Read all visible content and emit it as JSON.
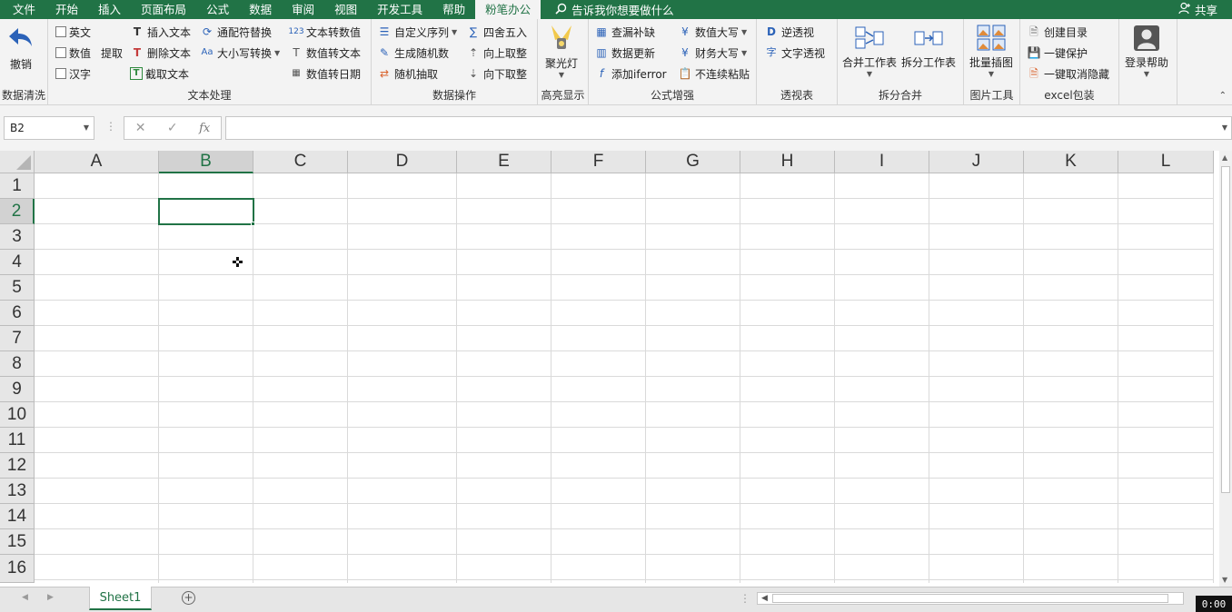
{
  "menu": {
    "items": [
      "文件",
      "开始",
      "插入",
      "页面布局",
      "公式",
      "数据",
      "审阅",
      "视图",
      "开发工具",
      "帮助",
      "粉笔办公"
    ],
    "active_index": 10,
    "search_text": "告诉我你想要做什么",
    "share_label": "共享"
  },
  "ribbon": {
    "clean": {
      "undo_label": "撤销",
      "group_label": "数据清洗"
    },
    "text": {
      "check_english": "英文",
      "check_number": "数值",
      "check_chinese": "汉字",
      "extract": "提取",
      "insert_text": "插入文本",
      "delete_text": "删除文本",
      "cut_text": "截取文本",
      "wildcard": "通配符替换",
      "case_convert": "大小写转换",
      "text_to_num": "文本转数值",
      "num_to_text": "数值转文本",
      "num_to_date": "数值转日期",
      "group_label": "文本处理"
    },
    "dataops": {
      "custom_seq": "自定义序列",
      "gen_random": "生成随机数",
      "random_pick": "随机抽取",
      "round": "四舍五入",
      "round_up": "向上取整",
      "round_down": "向下取整",
      "group_label": "数据操作"
    },
    "highlight": {
      "spotlight": "聚光灯",
      "group_label": "高亮显示"
    },
    "formula": {
      "lookup_fill": "查漏补缺",
      "data_update": "数据更新",
      "add_iferror": "添加iferror",
      "num_upper": "数值大写",
      "fin_upper": "财务大写",
      "paste_noncont": "不连续粘贴",
      "group_label": "公式增强"
    },
    "pivot": {
      "reverse": "逆透视",
      "text_pivot": "文字透视",
      "group_label": "透视表"
    },
    "merge": {
      "merge_sheets": "合并工作表",
      "split_sheets": "拆分工作表",
      "group_label": "拆分合并"
    },
    "image": {
      "batch_insert": "批量插图",
      "group_label": "图片工具"
    },
    "pack": {
      "create_toc": "创建目录",
      "protect": "一键保护",
      "unhide": "一键取消隐藏",
      "group_label": "excel包装"
    },
    "login": {
      "label": "登录帮助"
    }
  },
  "formula_bar": {
    "name_box": "B2",
    "fx": "fx",
    "value": ""
  },
  "grid": {
    "columns": [
      "A",
      "B",
      "C",
      "D",
      "E",
      "F",
      "G",
      "H",
      "I",
      "J",
      "K",
      "L"
    ],
    "rows": [
      "1",
      "2",
      "3",
      "4",
      "5",
      "6",
      "7",
      "8",
      "9",
      "10",
      "11",
      "12",
      "13",
      "14",
      "15",
      "16"
    ],
    "selected_cell": "B2"
  },
  "sheets": {
    "tabs": [
      "Sheet1"
    ],
    "active": "Sheet1"
  },
  "timestamp": "0:00",
  "colors": {
    "accent": "#217346",
    "ribbon_bg": "#f3f3f3",
    "header_bg": "#e6e6e6",
    "gridline": "#dadada"
  }
}
